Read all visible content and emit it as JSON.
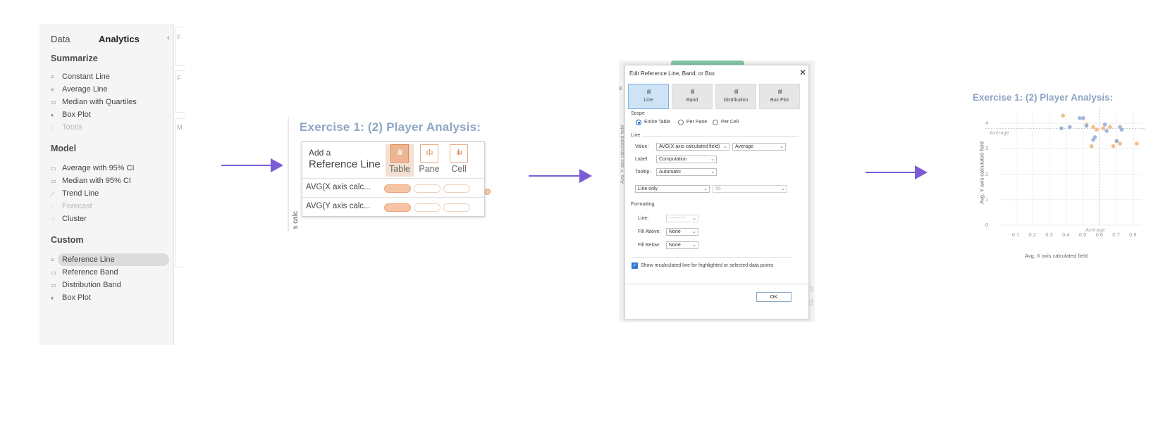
{
  "analytics_pane": {
    "tabs": {
      "data": "Data",
      "analytics": "Analytics"
    },
    "collapse": "‹",
    "sections": [
      {
        "title": "Summarize",
        "items": [
          {
            "label": "Constant Line",
            "icon": "constant-line-icon",
            "disabled": false
          },
          {
            "label": "Average Line",
            "icon": "average-line-icon",
            "disabled": false
          },
          {
            "label": "Median with Quartiles",
            "icon": "median-quartiles-icon",
            "disabled": false
          },
          {
            "label": "Box Plot",
            "icon": "box-plot-icon",
            "disabled": false
          },
          {
            "label": "Totals",
            "icon": "totals-icon",
            "disabled": true
          }
        ]
      },
      {
        "title": "Model",
        "items": [
          {
            "label": "Average with 95% CI",
            "icon": "average-ci-icon",
            "disabled": false
          },
          {
            "label": "Median with 95% CI",
            "icon": "median-ci-icon",
            "disabled": false
          },
          {
            "label": "Trend Line",
            "icon": "trend-line-icon",
            "disabled": false
          },
          {
            "label": "Forecast",
            "icon": "forecast-icon",
            "disabled": true
          },
          {
            "label": "Cluster",
            "icon": "cluster-icon",
            "disabled": false
          }
        ]
      },
      {
        "title": "Custom",
        "items": [
          {
            "label": "Reference Line",
            "icon": "reference-line-icon",
            "disabled": false,
            "selected": true
          },
          {
            "label": "Reference Band",
            "icon": "reference-band-icon",
            "disabled": false
          },
          {
            "label": "Distribution Band",
            "icon": "distribution-band-icon",
            "disabled": false
          },
          {
            "label": "Box Plot",
            "icon": "box-plot-icon",
            "disabled": false
          }
        ]
      }
    ]
  },
  "arrow_color": "#7b5cd6",
  "add_ref_line": {
    "sheet_title": "Exercise 1: (2) Player Analysis:",
    "header_line1": "Add a",
    "header_line2": "Reference Line",
    "options": [
      {
        "label": "Table",
        "icon": "table-scope-icon",
        "active": true
      },
      {
        "label": "Pane",
        "icon": "pane-scope-icon",
        "active": false
      },
      {
        "label": "Cell",
        "icon": "cell-scope-icon",
        "active": false
      }
    ],
    "fields": [
      {
        "label": "AVG(X axis calc...",
        "selected": "Table"
      },
      {
        "label": "AVG(Y axis calc...",
        "selected": "Table"
      }
    ],
    "axis_fragment": "s calc",
    "accent": "#edb591"
  },
  "edit_dialog": {
    "title": "Edit Reference Line, Band, or Box",
    "close": "✕",
    "type_tabs": [
      {
        "label": "Line",
        "active": true
      },
      {
        "label": "Band",
        "active": false
      },
      {
        "label": "Distribution",
        "active": false
      },
      {
        "label": "Box Plot",
        "active": false
      }
    ],
    "scope_title": "Scope",
    "scope_options": [
      {
        "label": "Entire Table",
        "checked": true
      },
      {
        "label": "Per Pane",
        "checked": false
      },
      {
        "label": "Per Cell",
        "checked": false
      }
    ],
    "line_section": "Line",
    "value_label": "Value:",
    "value_field": "AVG(X axis calculated field)",
    "value_agg": "Average",
    "label_label": "Label:",
    "label_value": "Computation",
    "tooltip_label": "Tooltip:",
    "tooltip_value": "Automatic",
    "line_style": "Line only",
    "confidence": "95",
    "formatting_title": "Formatting",
    "fmt_line_label": "Line:",
    "fmt_line_value": "----------",
    "fill_above_label": "Fill Above:",
    "fill_above_value": "None",
    "fill_below_label": "Fill Below:",
    "fill_below_value": "None",
    "recalc_checkbox": "Show recalculated line for highlighted or selected data points",
    "ok_label": "OK",
    "side_axis_text": "Avg. Y axis calculated field"
  },
  "result_chart": {
    "title": "Exercise 1: (2) Player Analysis:",
    "y_ticks": [
      "0",
      "1",
      "2",
      "3",
      "4"
    ],
    "x_ticks": [
      "0.1",
      "0.2",
      "0.3",
      "0.4",
      "0.5",
      "0.6",
      "0.7",
      "0.8"
    ],
    "x_avg_label": "Average",
    "y_avg_label": "Average"
  },
  "chart_data": {
    "type": "scatter",
    "title": "Exercise 1: (2) Player Analysis:",
    "xlabel": "Avg. X axis calculated field",
    "ylabel": "Avg. Y axis calculated field",
    "xlim": [
      0,
      0.85
    ],
    "ylim": [
      0,
      4.5
    ],
    "grid": true,
    "reference_lines": [
      {
        "axis": "x",
        "value": 0.6,
        "label": "Average"
      },
      {
        "axis": "y",
        "value": 3.8,
        "label": "Average"
      }
    ],
    "series": [
      {
        "color": "#f0b27a",
        "points": [
          [
            0.38,
            4.3
          ],
          [
            0.52,
            3.95
          ],
          [
            0.56,
            3.85
          ],
          [
            0.58,
            3.75
          ],
          [
            0.62,
            3.8
          ],
          [
            0.66,
            3.85
          ],
          [
            0.7,
            3.3
          ],
          [
            0.68,
            3.1
          ],
          [
            0.72,
            3.2
          ],
          [
            0.82,
            3.2
          ],
          [
            0.55,
            3.1
          ]
        ]
      },
      {
        "color": "#8fa8d0",
        "points": [
          [
            0.37,
            3.8
          ],
          [
            0.42,
            3.85
          ],
          [
            0.48,
            4.2
          ],
          [
            0.5,
            4.2
          ],
          [
            0.52,
            3.9
          ],
          [
            0.57,
            3.45
          ],
          [
            0.56,
            3.35
          ],
          [
            0.63,
            3.95
          ],
          [
            0.64,
            3.7
          ],
          [
            0.7,
            3.3
          ],
          [
            0.72,
            3.85
          ],
          [
            0.73,
            3.75
          ]
        ]
      }
    ]
  }
}
